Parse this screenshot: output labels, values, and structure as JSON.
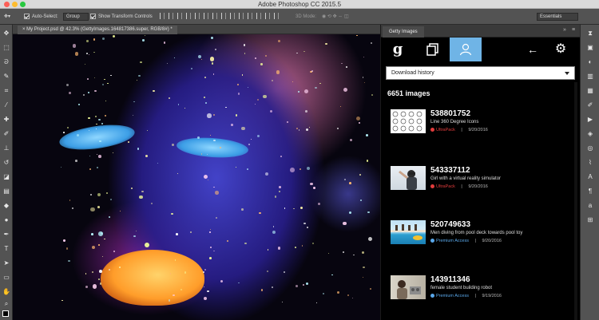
{
  "window": {
    "title": "Adobe Photoshop CC 2015.5"
  },
  "options_bar": {
    "auto_select_label": "Auto-Select:",
    "auto_select_value": "Group",
    "transform_label": "Show Transform Controls",
    "mode_label": "3D Mode:",
    "workspace": "Essentials"
  },
  "document": {
    "tab_label": "My Project.psd @ 42.3% (GettyImages.164817386.super, RGB/8#) *"
  },
  "panel": {
    "tab_label": "Getty Images",
    "nav": {
      "logo": "g",
      "back_glyph": "←",
      "settings_glyph": "⚙"
    },
    "dropdown_value": "Download history",
    "image_count": "6651 images",
    "results": [
      {
        "id": "538801752",
        "caption": "Line 360 Degree Icons",
        "collection": "UltraPack",
        "collection_color": "#e23c3c",
        "date": "9/20/2016"
      },
      {
        "id": "543337112",
        "caption": "Girl with a virtual reality simulator",
        "collection": "UltraPack",
        "collection_color": "#e23c3c",
        "date": "9/20/2016"
      },
      {
        "id": "520749633",
        "caption": "Men diving from pool deck towards pool toy",
        "collection": "Premium Access",
        "collection_color": "#5aa8ea",
        "date": "9/20/2016"
      },
      {
        "id": "143911346",
        "caption": "female student building robot",
        "collection": "Premium Access",
        "collection_color": "#5aa8ea",
        "date": "9/19/2016"
      }
    ],
    "separator": "|"
  },
  "icons": {
    "tools": [
      "move-icon",
      "marquee-icon",
      "lasso-icon",
      "quick-select-icon",
      "crop-icon",
      "eyedropper-icon",
      "healing-icon",
      "brush-icon",
      "stamp-icon",
      "history-brush-icon",
      "eraser-icon",
      "gradient-icon",
      "blur-icon",
      "dodge-icon",
      "pen-icon",
      "type-icon",
      "path-select-icon",
      "shape-icon",
      "hand-icon",
      "zoom-icon"
    ]
  }
}
